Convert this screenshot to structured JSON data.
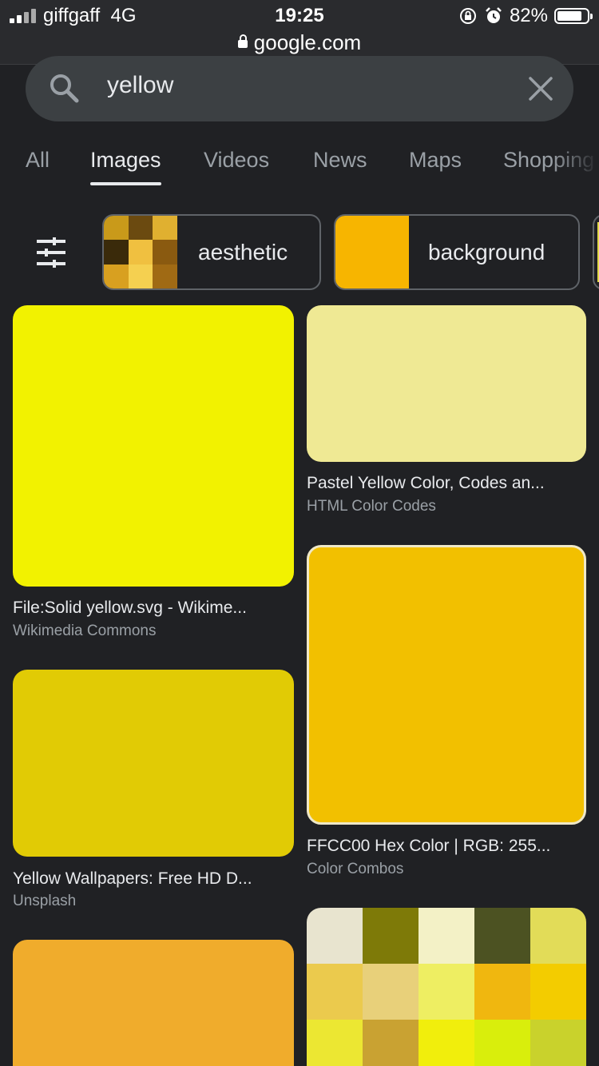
{
  "status_bar": {
    "carrier": "giffgaff",
    "network": "4G",
    "time": "19:25",
    "battery": "82%",
    "battery_level": 0.82,
    "url": "google.com"
  },
  "search": {
    "query": "yellow"
  },
  "tabs": [
    {
      "label": "All",
      "active": false
    },
    {
      "label": "Images",
      "active": true
    },
    {
      "label": "Videos",
      "active": false
    },
    {
      "label": "News",
      "active": false
    },
    {
      "label": "Maps",
      "active": false
    },
    {
      "label": "Shopping",
      "active": false
    }
  ],
  "chips": [
    {
      "label": "aesthetic",
      "thumb_colors": [
        "#c99a1a",
        "#6b4a10",
        "#e0b030",
        "#3a2a0a",
        "#f0c040",
        "#8a5a10",
        "#d8a020",
        "#f5d050",
        "#a06a14"
      ]
    },
    {
      "label": "background",
      "thumb_color": "#f7b500"
    }
  ],
  "results": [
    {
      "title": "File:Solid yellow.svg - Wikime...",
      "source": "Wikimedia Commons",
      "color": "#f2f200"
    },
    {
      "title": "Pastel Yellow Color, Codes an...",
      "source": "HTML Color Codes",
      "color": "#efe994"
    },
    {
      "title": "Yellow Wallpapers: Free HD D...",
      "source": "Unsplash",
      "color": "#e1cb05"
    },
    {
      "title": "FFCC00 Hex Color | RGB: 255...",
      "source": "Color Combos",
      "color": "#f2c000"
    },
    {
      "color": "#f0ac2c"
    }
  ],
  "palette_colors": [
    "#e8e4cf",
    "#7e7a08",
    "#f3f1c6",
    "#4c5222",
    "#e2dc58",
    "#ebca4d",
    "#e8d07a",
    "#eeee62",
    "#f0b70f",
    "#f3cc00",
    "#ece732",
    "#c9a232",
    "#f1ee0c",
    "#d9ee0c",
    "#c9d22c"
  ]
}
